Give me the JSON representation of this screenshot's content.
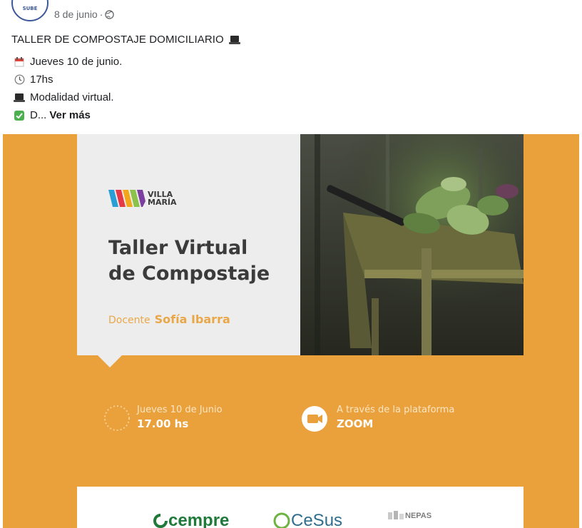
{
  "post": {
    "avatar_text": "SUBE",
    "date": "8 de junio",
    "separator": "·",
    "title": "TALLER DE COMPOSTAJE DOMICILIARIO",
    "lines": [
      {
        "icon": "calendar-icon",
        "text": "Jueves 10 de junio."
      },
      {
        "icon": "clock-icon",
        "text": "17hs"
      },
      {
        "icon": "laptop-icon",
        "text": "Modalidad virtual."
      },
      {
        "icon": "check-icon",
        "text": "D..."
      }
    ],
    "see_more": "Ver más"
  },
  "flyer": {
    "logo_line1": "VILLA",
    "logo_line2": "MARÍA",
    "title_line1": "Taller Virtual",
    "title_line2": "de Compostaje",
    "teacher_label": "Docente",
    "teacher_name": "Sofía Ibarra",
    "date_text": "Jueves 10 de Junio",
    "time_text": "17.00 hs",
    "platform_text": "A través de la plataforma",
    "platform_name": "ZOOM",
    "sponsors": [
      "cempre",
      "CeSus",
      "NEPAS"
    ]
  },
  "colors": {
    "flyer_orange": "#eaa03b",
    "card_gray": "#eeeded",
    "title_dark": "#3b3b3b",
    "teacher_orange": "#e9a748",
    "link_blue": "#3b5998"
  }
}
